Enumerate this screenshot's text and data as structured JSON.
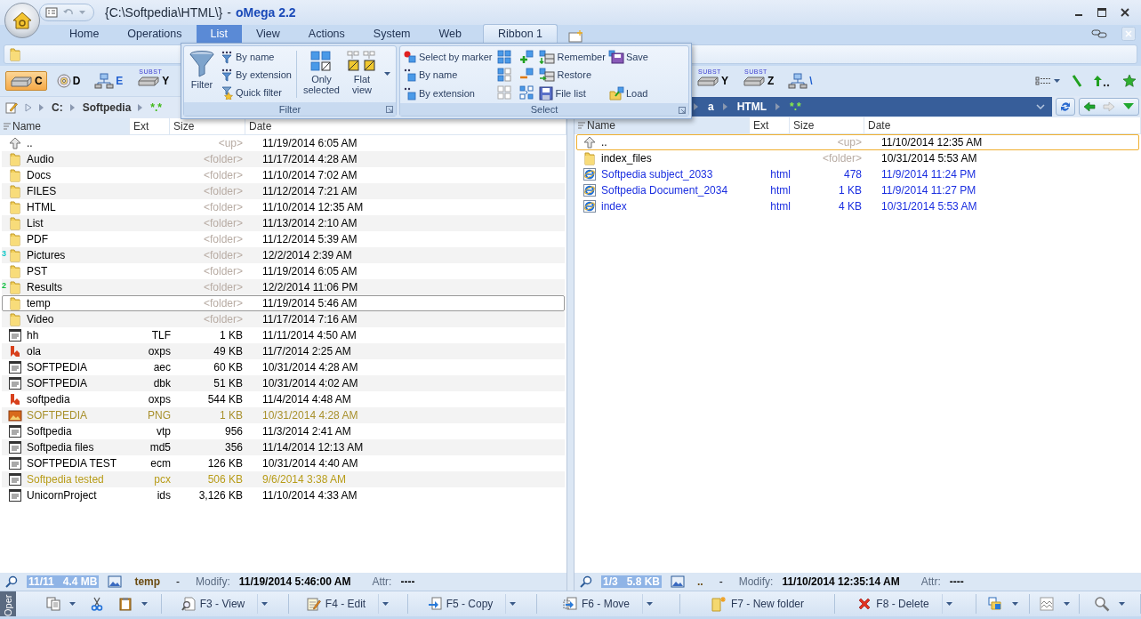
{
  "window": {
    "path": "{C:\\Softpedia\\HTML\\}",
    "separator": "-",
    "app_name": "oMega 2.2"
  },
  "tabs": [
    {
      "label": "Home",
      "kind": "normal",
      "selected": false
    },
    {
      "label": "Operations",
      "kind": "normal",
      "selected": false
    },
    {
      "label": "List",
      "kind": "normal",
      "selected": true
    },
    {
      "label": "View",
      "kind": "normal",
      "selected": false
    },
    {
      "label": "Actions",
      "kind": "normal",
      "selected": false
    },
    {
      "label": "System",
      "kind": "normal",
      "selected": false
    },
    {
      "label": "Web",
      "kind": "normal",
      "selected": false
    },
    {
      "label": "Ribbon 1",
      "kind": "contextual",
      "selected": false
    }
  ],
  "ribbon_panel": {
    "groups": [
      {
        "title": "Filter",
        "columns": [
          {
            "kind": "large",
            "buttons": [
              {
                "kind": "labeled",
                "label": "Filter"
              }
            ]
          },
          {
            "kind": "small",
            "buttons": [
              {
                "kind": "labeled",
                "label": "By name"
              },
              {
                "kind": "labeled",
                "label": "By extension"
              },
              {
                "kind": "labeled",
                "label": "Quick filter"
              }
            ]
          },
          {
            "kind": "separator"
          },
          {
            "kind": "large",
            "buttons": [
              {
                "kind": "labeled",
                "label": "Only selected"
              }
            ]
          },
          {
            "kind": "large",
            "buttons": [
              {
                "kind": "labeled",
                "label": "Flat view"
              }
            ]
          },
          {
            "kind": "menu"
          }
        ]
      },
      {
        "title": "Select",
        "columns": [
          {
            "kind": "small",
            "buttons": [
              {
                "kind": "labeled",
                "label": "Select by marker"
              },
              {
                "kind": "labeled",
                "label": "By name"
              },
              {
                "kind": "labeled",
                "label": "By extension"
              }
            ]
          },
          {
            "kind": "small",
            "buttons": [
              {
                "kind": "icon"
              },
              {
                "kind": "icon"
              },
              {
                "kind": "icon"
              }
            ]
          },
          {
            "kind": "small",
            "buttons": [
              {
                "kind": "icon"
              },
              {
                "kind": "icon"
              },
              {
                "kind": "icon"
              }
            ]
          },
          {
            "kind": "small",
            "buttons": [
              {
                "kind": "labeled",
                "label": "Remember"
              },
              {
                "kind": "labeled",
                "label": "Restore"
              },
              {
                "kind": "labeled",
                "label": "File list"
              }
            ]
          },
          {
            "kind": "small",
            "buttons": [
              {
                "kind": "labeled",
                "label": "Save"
              },
              {
                "kind": "labeled",
                "label": "Load"
              }
            ]
          }
        ]
      }
    ]
  },
  "panels": [
    {
      "active": false,
      "drives": [
        {
          "letter": "C",
          "kind": "hdd",
          "color": "#000000",
          "selected": true
        },
        {
          "letter": "D",
          "kind": "cd",
          "color": "#000000",
          "selected": false
        },
        {
          "letter": "E",
          "kind": "network",
          "color": "#1f5fd0",
          "selected": false
        },
        {
          "letter": "Y",
          "kind": "subst",
          "badge": "SUBST",
          "color": "#000000",
          "selected": false
        }
      ],
      "path": {
        "segments": [
          "C:",
          "Softpedia"
        ],
        "mask": "*.*"
      },
      "columns": [
        "Name",
        "Ext",
        "Size",
        "Date"
      ],
      "rows": [
        {
          "kind": "up",
          "name": "..",
          "size": "<up>",
          "date": "11/19/2014 6:05 AM",
          "focused": false
        },
        {
          "kind": "folder",
          "name": "Audio",
          "size": "<folder>",
          "date": "11/17/2014 4:28 AM",
          "color": "#000000",
          "focused": false
        },
        {
          "kind": "folder",
          "name": "Docs",
          "size": "<folder>",
          "date": "11/10/2014 7:02 AM",
          "color": "#000000",
          "focused": false
        },
        {
          "kind": "folder",
          "name": "FILES",
          "size": "<folder>",
          "date": "11/12/2014 7:21 AM",
          "color": "#000000",
          "focused": false
        },
        {
          "kind": "folder",
          "name": "HTML",
          "size": "<folder>",
          "date": "11/10/2014 12:35 AM",
          "color": "#000000",
          "focused": false
        },
        {
          "kind": "folder",
          "name": "List",
          "size": "<folder>",
          "date": "11/13/2014 2:10 AM",
          "color": "#000000",
          "focused": false
        },
        {
          "kind": "folder",
          "name": "PDF",
          "size": "<folder>",
          "date": "11/12/2014 5:39 AM",
          "color": "#000000",
          "focused": false
        },
        {
          "kind": "folder",
          "name": "Pictures",
          "size": "<folder>",
          "date": "12/2/2014 2:39 AM",
          "color": "#000000",
          "focused": false,
          "mark": {
            "text": "3",
            "color": "#10c8c8"
          }
        },
        {
          "kind": "folder",
          "name": "PST",
          "size": "<folder>",
          "date": "11/19/2014 6:05 AM",
          "color": "#000000",
          "focused": false
        },
        {
          "kind": "folder",
          "name": "Results",
          "size": "<folder>",
          "date": "12/2/2014 11:06 PM",
          "color": "#000000",
          "focused": false,
          "mark": {
            "text": "2",
            "color": "#10c040"
          }
        },
        {
          "kind": "folder",
          "name": "temp",
          "size": "<folder>",
          "date": "11/19/2014 5:46 AM",
          "color": "#000000",
          "focused": true
        },
        {
          "kind": "folder",
          "name": "Video",
          "size": "<folder>",
          "date": "11/17/2014 7:16 AM",
          "color": "#000000",
          "focused": false
        },
        {
          "kind": "file",
          "name": "hh",
          "ext": "TLF",
          "size": "1 KB",
          "date": "11/11/2014 4:50 AM",
          "focused": false
        },
        {
          "kind": "xps",
          "name": "ola",
          "ext": "oxps",
          "size": "49 KB",
          "date": "11/7/2014 2:25 AM",
          "color": "#000000",
          "focused": false
        },
        {
          "kind": "file",
          "name": "SOFTPEDIA",
          "ext": "aec",
          "size": "60 KB",
          "date": "10/31/2014 4:28 AM",
          "color": "#000000",
          "focused": false
        },
        {
          "kind": "file",
          "name": "SOFTPEDIA",
          "ext": "dbk",
          "size": "51 KB",
          "date": "10/31/2014 4:02 AM",
          "color": "#000000",
          "focused": false
        },
        {
          "kind": "xps",
          "name": "softpedia",
          "ext": "oxps",
          "size": "544 KB",
          "date": "11/4/2014 4:48 AM",
          "color": "#000000",
          "focused": false
        },
        {
          "kind": "image",
          "name": "SOFTPEDIA",
          "ext": "PNG",
          "size": "1 KB",
          "date": "10/31/2014 4:28 AM",
          "color": "#a8902c",
          "focused": false
        },
        {
          "kind": "file",
          "name": "Softpedia",
          "ext": "vtp",
          "size": "956",
          "date": "11/3/2014 2:41 AM",
          "color": "#000000",
          "focused": false
        },
        {
          "kind": "file",
          "name": "Softpedia files",
          "ext": "md5",
          "size": "356",
          "date": "11/14/2014 12:13 AM",
          "color": "#000000",
          "focused": false
        },
        {
          "kind": "file",
          "name": "SOFTPEDIA TEST",
          "ext": "ecm",
          "size": "126 KB",
          "date": "10/31/2014 4:40 AM",
          "color": "#000000",
          "focused": false
        },
        {
          "kind": "file",
          "name": "Softpedia tested",
          "ext": "pcx",
          "size": "506 KB",
          "date": "9/6/2014 3:38 AM",
          "color": "#b89c18",
          "focused": false
        },
        {
          "kind": "file",
          "name": "UnicornProject",
          "ext": "ids",
          "size": "3,126 KB",
          "date": "11/10/2014 4:33 AM",
          "color": "#000000",
          "focused": false
        }
      ],
      "status": {
        "selection": "11/11   4.4 MB",
        "name": "temp",
        "separator": "-",
        "modify_label": "Modify:",
        "modified": "11/19/2014 5:46:00 AM",
        "attr_label": "Attr:",
        "attributes": "----"
      }
    },
    {
      "active": true,
      "drives": [
        {
          "letter": "Y",
          "kind": "subst",
          "badge": "SUBST",
          "color": "#000000",
          "selected": false
        },
        {
          "letter": "Z",
          "kind": "subst",
          "badge": "SUBST",
          "color": "#000000",
          "selected": false
        },
        {
          "letter": "\\",
          "kind": "network",
          "color": "#1f5fd0",
          "selected": false
        }
      ],
      "path": {
        "segments": [
          "a",
          "HTML"
        ],
        "mask": "*.*"
      },
      "columns": [
        "Name",
        "Ext",
        "Size",
        "Date"
      ],
      "rows": [
        {
          "kind": "up",
          "name": "..",
          "size": "<up>",
          "date": "11/10/2014 12:35 AM",
          "focused": true
        },
        {
          "kind": "folder",
          "name": "index_files",
          "size": "<folder>",
          "date": "10/31/2014 5:53 AM",
          "color": "#000000",
          "focused": false
        },
        {
          "kind": "html",
          "name": "Softpedia subject_2033",
          "ext": "html",
          "size": "478",
          "date": "11/9/2014 11:24 PM",
          "color": "#1a2ee0",
          "focused": false
        },
        {
          "kind": "html",
          "name": "Softpedia Document_2034",
          "ext": "html",
          "size": "1 KB",
          "date": "11/9/2014 11:27 PM",
          "color": "#1a2ee0",
          "focused": false
        },
        {
          "kind": "html",
          "name": "index",
          "ext": "html",
          "size": "4 KB",
          "date": "10/31/2014 5:53 AM",
          "color": "#1a2ee0",
          "focused": false
        }
      ],
      "status": {
        "selection": "1/3   5.8 KB",
        "name": "..",
        "separator": "-",
        "modify_label": "Modify:",
        "modified": "11/10/2014 12:35:14 AM",
        "attr_label": "Attr:",
        "attributes": "----"
      }
    }
  ],
  "function_bar": {
    "tab_label": "Oper",
    "segments": [
      {
        "buttons": [
          {
            "kind": "copy",
            "dropdown": true
          },
          {
            "kind": "cut",
            "dropdown": false
          },
          {
            "kind": "paste",
            "dropdown": true
          }
        ]
      },
      {
        "buttons": [
          {
            "kind": "view",
            "label": "F3 - View",
            "dropdown": true
          }
        ]
      },
      {
        "buttons": [
          {
            "kind": "edit",
            "label": "F4 - Edit",
            "dropdown": true
          }
        ]
      },
      {
        "buttons": [
          {
            "kind": "copy-to",
            "label": "F5 - Copy",
            "dropdown": true
          }
        ]
      },
      {
        "buttons": [
          {
            "kind": "move",
            "label": "F6 - Move",
            "dropdown": true
          }
        ]
      },
      {
        "buttons": [
          {
            "kind": "new-folder",
            "label": "F7 - New folder",
            "dropdown": false
          }
        ]
      },
      {
        "buttons": [
          {
            "kind": "delete",
            "label": "F8 - Delete",
            "dropdown": true
          }
        ]
      },
      {
        "buttons": [
          {
            "kind": "sync",
            "dropdown": true
          }
        ]
      },
      {
        "buttons": [
          {
            "kind": "compare",
            "dropdown": true
          }
        ]
      },
      {
        "buttons": [
          {
            "kind": "search",
            "dropdown": true
          }
        ]
      }
    ]
  }
}
